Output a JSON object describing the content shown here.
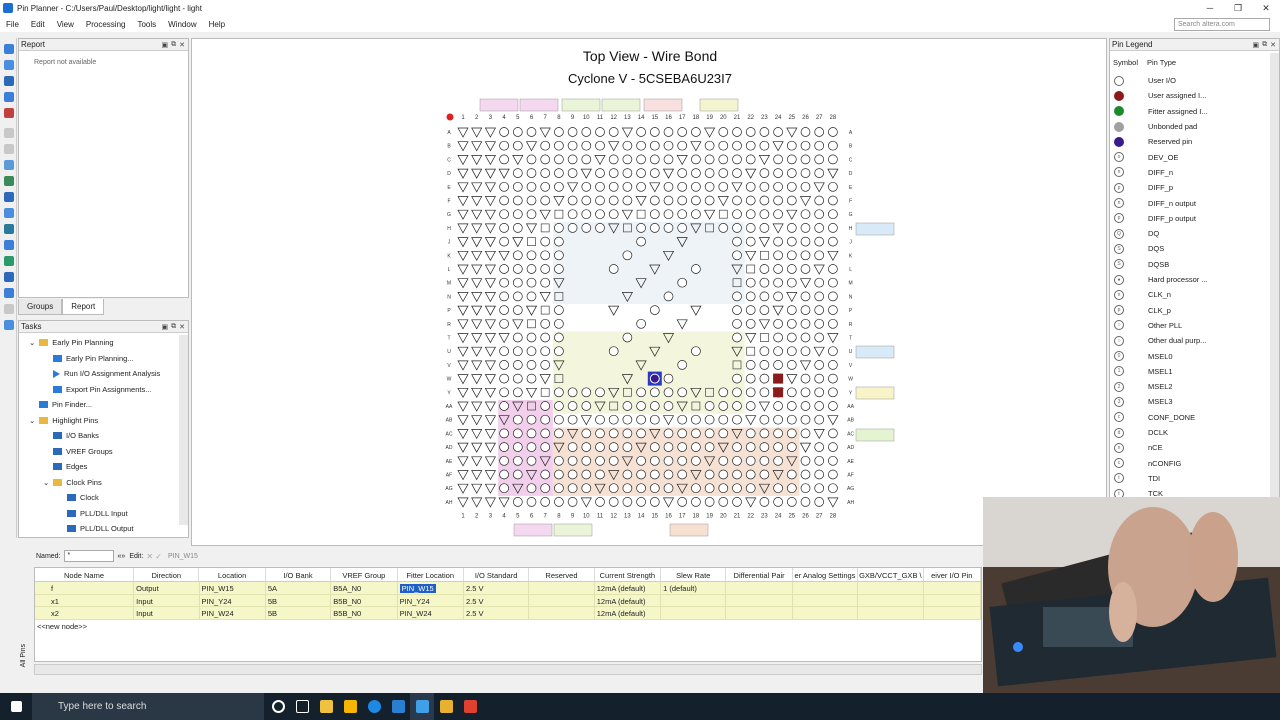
{
  "window": {
    "title": "Pin Planner - C:/Users/Paul/Desktop/light/light - light",
    "min": "─",
    "restore": "❐",
    "close": "✕"
  },
  "menu": [
    "File",
    "Edit",
    "View",
    "Processing",
    "Tools",
    "Window",
    "Help"
  ],
  "search": {
    "placeholder": "Search altera.com"
  },
  "report": {
    "title": "Report",
    "empty": "Report not available"
  },
  "lefttabs": [
    "Groups",
    "Report"
  ],
  "tasks": {
    "title": "Tasks",
    "items": [
      {
        "label": "Early Pin Planning",
        "level": 1,
        "icon": "folder-icon"
      },
      {
        "label": "Early Pin Planning...",
        "level": 2,
        "icon": "window-icon"
      },
      {
        "label": "Run I/O Assignment Analysis",
        "level": 2,
        "icon": "play-icon"
      },
      {
        "label": "Export Pin Assignments...",
        "level": 2,
        "icon": "window-icon"
      },
      {
        "label": "Pin Finder...",
        "level": 1,
        "icon": "window-icon"
      },
      {
        "label": "Highlight Pins",
        "level": 1,
        "icon": "folder-icon"
      },
      {
        "label": "I/O Banks",
        "level": 2,
        "icon": "grid-icon"
      },
      {
        "label": "VREF Groups",
        "level": 2,
        "icon": "grid-icon"
      },
      {
        "label": "Edges",
        "level": 2,
        "icon": "grid-icon"
      },
      {
        "label": "Clock Pins",
        "level": 2,
        "icon": "folder-icon"
      },
      {
        "label": "Clock",
        "level": 3,
        "icon": "grid-icon"
      },
      {
        "label": "PLL/DLL Input",
        "level": 3,
        "icon": "grid-icon"
      },
      {
        "label": "PLL/DLL Output",
        "level": 3,
        "icon": "grid-icon"
      }
    ]
  },
  "view": {
    "title": "Top View - Wire Bond",
    "device": "Cyclone V - 5CSEBA6U23I7",
    "cols": [
      "1",
      "2",
      "3",
      "4",
      "5",
      "6",
      "7",
      "8",
      "9",
      "10",
      "11",
      "12",
      "13",
      "14",
      "15",
      "16",
      "17",
      "18",
      "19",
      "20",
      "21",
      "22",
      "23",
      "24",
      "25",
      "26",
      "27",
      "28"
    ],
    "rows": [
      "A",
      "B",
      "C",
      "D",
      "E",
      "F",
      "G",
      "H",
      "J",
      "K",
      "L",
      "M",
      "N",
      "P",
      "R",
      "T",
      "U",
      "V",
      "W",
      "Y",
      "AA",
      "AB",
      "AC",
      "AD",
      "AE",
      "AF",
      "AG",
      "AH"
    ]
  },
  "legend": {
    "title": "Pin Legend",
    "col_symbol": "Symbol",
    "col_type": "Pin Type",
    "items": [
      {
        "label": "User I/O",
        "color": "#ffffff",
        "glyph": ""
      },
      {
        "label": "User assigned I...",
        "color": "#8b1a1a",
        "glyph": ""
      },
      {
        "label": "Fitter assigned I...",
        "color": "#1a8a2a",
        "glyph": ""
      },
      {
        "label": "Unbonded pad",
        "color": "#a0a0a0",
        "glyph": ""
      },
      {
        "label": "Reserved pin",
        "color": "#3a1a8a",
        "glyph": ""
      },
      {
        "label": "DEV_OE",
        "color": "#ffffff",
        "glyph": "o"
      },
      {
        "label": "DIFF_n",
        "color": "#ffffff",
        "glyph": "n"
      },
      {
        "label": "DIFF_p",
        "color": "#ffffff",
        "glyph": "p"
      },
      {
        "label": "DIFF_n output",
        "color": "#ffffff",
        "glyph": "n"
      },
      {
        "label": "DIFF_p output",
        "color": "#ffffff",
        "glyph": "p"
      },
      {
        "label": "DQ",
        "color": "#ffffff",
        "glyph": "Q"
      },
      {
        "label": "DQS",
        "color": "#ffffff",
        "glyph": "S"
      },
      {
        "label": "DQSB",
        "color": "#ffffff",
        "glyph": "S"
      },
      {
        "label": "Hard processor ...",
        "color": "#ffffff",
        "glyph": "●"
      },
      {
        "label": "CLK_n",
        "color": "#ffffff",
        "glyph": "n"
      },
      {
        "label": "CLK_p",
        "color": "#ffffff",
        "glyph": "p"
      },
      {
        "label": "Other PLL",
        "color": "#ffffff",
        "glyph": "○"
      },
      {
        "label": "Other dual purp...",
        "color": "#ffffff",
        "glyph": "○"
      },
      {
        "label": "MSEL0",
        "color": "#ffffff",
        "glyph": "0"
      },
      {
        "label": "MSEL1",
        "color": "#ffffff",
        "glyph": "1"
      },
      {
        "label": "MSEL2",
        "color": "#ffffff",
        "glyph": "2"
      },
      {
        "label": "MSEL3",
        "color": "#ffffff",
        "glyph": "3"
      },
      {
        "label": "CONF_DONE",
        "color": "#ffffff",
        "glyph": "c"
      },
      {
        "label": "DCLK",
        "color": "#ffffff",
        "glyph": "d"
      },
      {
        "label": "nCE",
        "color": "#ffffff",
        "glyph": "n"
      },
      {
        "label": "nCONFIG",
        "color": "#ffffff",
        "glyph": "c"
      },
      {
        "label": "TDI",
        "color": "#ffffff",
        "glyph": "t"
      },
      {
        "label": "TCK",
        "color": "#ffffff",
        "glyph": "t"
      }
    ]
  },
  "filter": {
    "named_label": "Named:",
    "named_value": "*",
    "edit_label": "Edit:",
    "edit_value": "PIN_W15",
    "expand": "«»"
  },
  "table": {
    "headers": [
      "Node Name",
      "Direction",
      "Location",
      "I/O Bank",
      "VREF Group",
      "Fitter Location",
      "I/O Standard",
      "Reserved",
      "Current Strength",
      "Slew Rate",
      "Differential Pair",
      "er Analog Settings",
      "GXB/VCCT_GXB \\",
      "eiver I/O Pin"
    ],
    "rows": [
      {
        "node": "f",
        "direction": "Output",
        "location": "PIN_W15",
        "bank": "5A",
        "vref": "B5A_N0",
        "fitter": "PIN_W15",
        "std": "2.5 V",
        "reserved": "",
        "current": "12mA (default)",
        "slew": "1 (default)"
      },
      {
        "node": "x1",
        "direction": "Input",
        "location": "PIN_Y24",
        "bank": "5B",
        "vref": "B5B_N0",
        "fitter": "PIN_Y24",
        "std": "2.5 V",
        "reserved": "",
        "current": "12mA (default)",
        "slew": ""
      },
      {
        "node": "x2",
        "direction": "Input",
        "location": "PIN_W24",
        "bank": "5B",
        "vref": "B5B_N0",
        "fitter": "PIN_W24",
        "std": "2.5 V",
        "reserved": "",
        "current": "12mA (default)",
        "slew": ""
      }
    ],
    "new_node": "<<new node>>"
  },
  "side_tab": "All Pins",
  "taskbar": {
    "search_placeholder": "Type here to search"
  }
}
